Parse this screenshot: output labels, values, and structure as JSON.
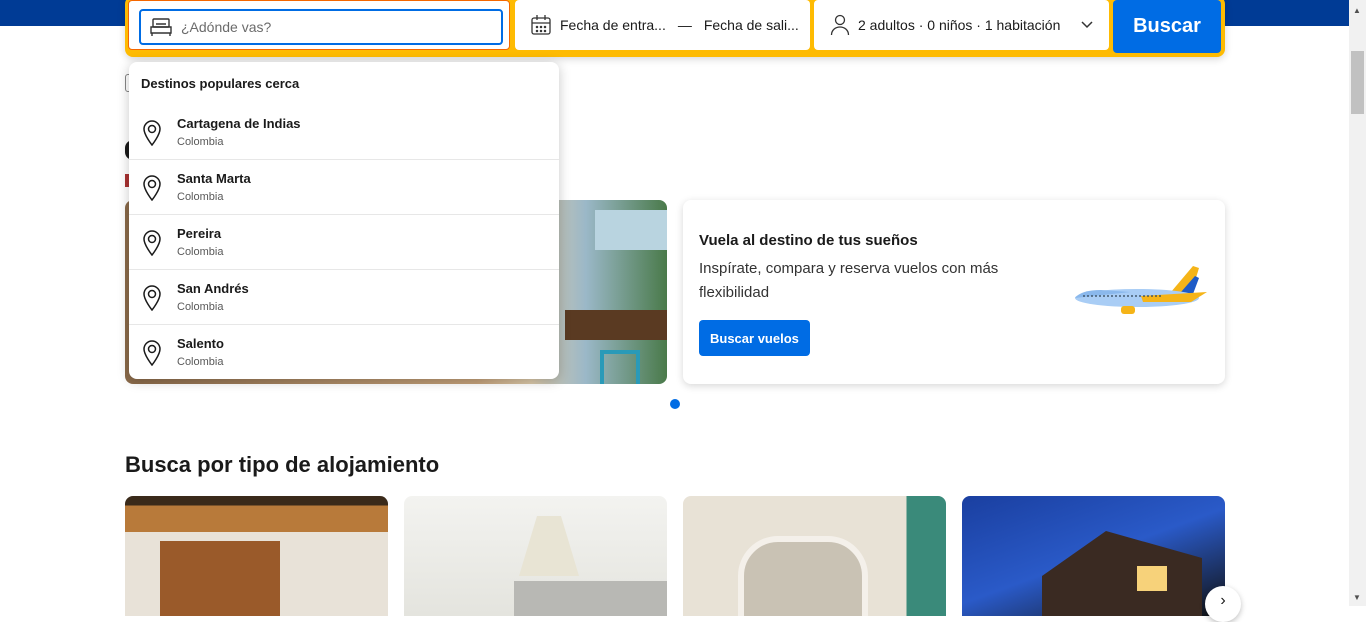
{
  "search": {
    "destination_placeholder": "¿Adónde vas?",
    "checkin": "Fecha de entra...",
    "date_separator": "—",
    "checkout": "Fecha de sali...",
    "guests": "2 adultos · 0 niños · 1 habitación",
    "button": "Buscar"
  },
  "dropdown": {
    "title": "Destinos populares cerca",
    "items": [
      {
        "name": "Cartagena de Indias",
        "country": "Colombia"
      },
      {
        "name": "Santa Marta",
        "country": "Colombia"
      },
      {
        "name": "Pereira",
        "country": "Colombia"
      },
      {
        "name": "San Andrés",
        "country": "Colombia"
      },
      {
        "name": "Salento",
        "country": "Colombia"
      }
    ]
  },
  "flights": {
    "title": "Vuela al destino de tus sueños",
    "description": "Inspírate, compara y reserva vuelos con más flexibilidad",
    "button": "Buscar vuelos"
  },
  "accommodation": {
    "title": "Busca por tipo de alojamiento",
    "next_icon": "›"
  },
  "colors": {
    "brand_blue": "#003b95",
    "accent": "#006ce4",
    "yellow": "#febb02"
  }
}
